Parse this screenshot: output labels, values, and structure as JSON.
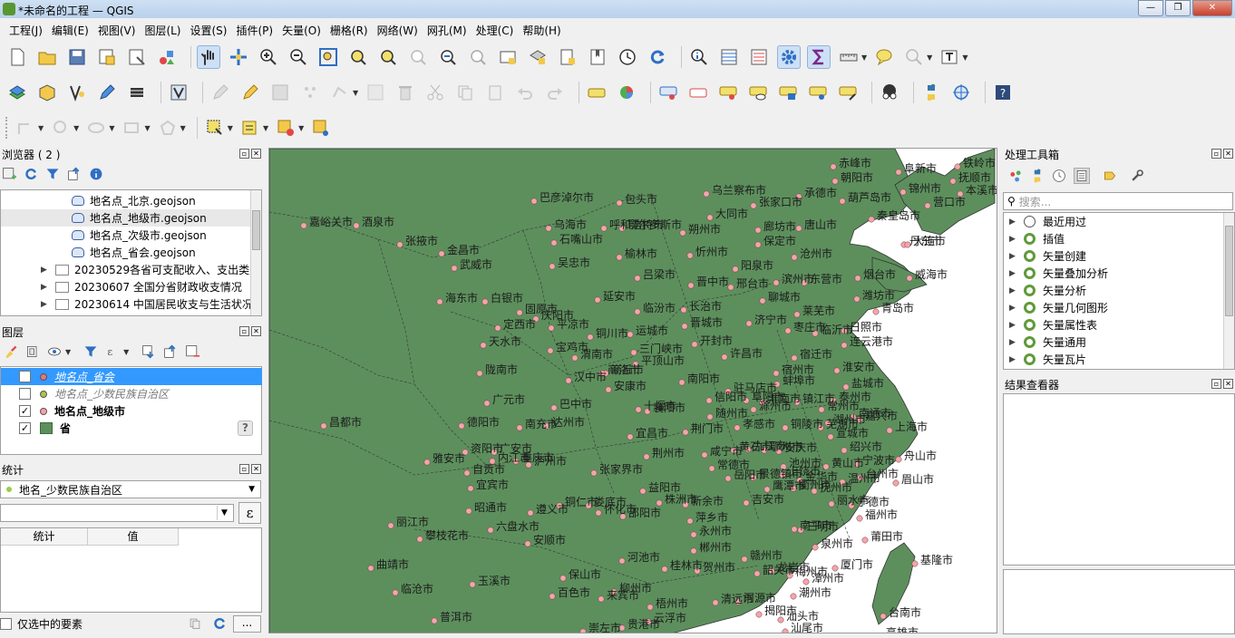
{
  "window": {
    "title": "*未命名的工程 — QGIS",
    "minimize": "—",
    "maximize": "❐",
    "close": "✕"
  },
  "menu": [
    "工程(J)",
    "编辑(E)",
    "视图(V)",
    "图层(L)",
    "设置(S)",
    "插件(P)",
    "矢量(O)",
    "栅格(R)",
    "网络(W)",
    "网孔(M)",
    "处理(C)",
    "帮助(H)"
  ],
  "browser": {
    "title": "浏览器 ( 2 )",
    "items": [
      {
        "label": "地名点_北京.geojson",
        "kind": "file"
      },
      {
        "label": "地名点_地级市.geojson",
        "kind": "file"
      },
      {
        "label": "地名点_次级市.geojson",
        "kind": "file"
      },
      {
        "label": "地名点_省会.geojson",
        "kind": "file"
      },
      {
        "label": "20230529各省可支配收入、支出类别",
        "kind": "folder"
      },
      {
        "label": "20230607 全国分省财政收支情况",
        "kind": "folder"
      },
      {
        "label": "20230614 中国居民收支与生活状况",
        "kind": "folder"
      }
    ]
  },
  "layers": {
    "title": "图层",
    "items": [
      {
        "label": "地名点_省会",
        "checked": false,
        "color": "#d67a86"
      },
      {
        "label": "地名点_少数民族自治区",
        "checked": false,
        "color": "#9acd4a"
      },
      {
        "label": "地名点_地级市",
        "checked": true,
        "color": "#f2a5ad"
      },
      {
        "label": "省",
        "checked": true,
        "color": "#5d8f5d"
      }
    ],
    "help_label": "?"
  },
  "stats": {
    "title": "统计",
    "layer_select": "地名_少数民族自治区",
    "col_stat": "统计",
    "col_value": "值",
    "only_selected": "仅选中的要素",
    "expr_button": "ε",
    "more_button": "..."
  },
  "tools": {
    "title": "处理工具箱",
    "search_placeholder": "搜索...",
    "items": [
      "最近用过",
      "插值",
      "矢量创建",
      "矢量叠加分析",
      "矢量分析",
      "矢量几何图形",
      "矢量属性表",
      "矢量通用",
      "矢量瓦片"
    ]
  },
  "results": {
    "title": "结果查看器"
  },
  "map": {
    "fill": "#5d8f5d",
    "sea": "#ffffff",
    "point_color": "#f2a5ad",
    "labels": [
      "赤峰市",
      "朝阳市",
      "阜新市",
      "铁岭市",
      "抚顺市",
      "锦州市",
      "本溪市",
      "营口市",
      "丹东市",
      "葫芦岛市",
      "秦皇岛市",
      "大连市",
      "乌兰察布市",
      "张家口市",
      "承德市",
      "大同市",
      "廊坊市",
      "唐山市",
      "保定市",
      "沧州市",
      "巴彦淖尔市",
      "包头市",
      "呼和浩特市",
      "乌海市",
      "鄂尔多斯市",
      "朔州市",
      "嘉峪关市",
      "酒泉市",
      "张掖市",
      "金昌市",
      "武威市",
      "石嘴山市",
      "吴忠市",
      "榆林市",
      "忻州市",
      "阳泉市",
      "吕梁市",
      "晋中市",
      "邢台市",
      "滨州市",
      "东营市",
      "烟台市",
      "威海市",
      "潍坊市",
      "青岛市",
      "日照市",
      "临沂市",
      "连云港市",
      "海东市",
      "白银市",
      "固原市",
      "庆阳市",
      "延安市",
      "临汾市",
      "长治市",
      "晋城市",
      "聊城市",
      "莱芜市",
      "济宁市",
      "枣庄市",
      "宿迁市",
      "定西市",
      "平凉市",
      "天水市",
      "宝鸡市",
      "铜川市",
      "渭南市",
      "运城市",
      "三门峡市",
      "开封市",
      "许昌市",
      "商丘市",
      "宿州市",
      "淮安市",
      "盐城市",
      "泰州市",
      "南通市",
      "上海市",
      "陇南市",
      "汉中市",
      "商洛市",
      "安康市",
      "平顶山市",
      "南阳市",
      "驻马店市",
      "阜阳市",
      "蚌埠市",
      "滁州市",
      "淮南市",
      "镇江市",
      "常州市",
      "湖州市",
      "嘉兴市",
      "舟山市",
      "广元市",
      "巴中市",
      "十堰市",
      "襄阳市",
      "信阳市",
      "随州市",
      "孝感市",
      "铜陵市",
      "芜湖市",
      "宣城市",
      "绍兴市",
      "宁波市",
      "台州市",
      "昌都市",
      "德阳市",
      "南充市",
      "达州市",
      "宜昌市",
      "荆门市",
      "荆州市",
      "鄂州市",
      "黄石市",
      "九江市",
      "安庆市",
      "池州市",
      "黄山市",
      "衢州市",
      "金华市",
      "温州市",
      "眉山市",
      "资阳市",
      "广安市",
      "雅安市",
      "内江市",
      "重庆市",
      "泸州市",
      "张家界市",
      "咸宁市",
      "常德市",
      "岳阳市",
      "景德镇市",
      "上饶市",
      "丽水市",
      "自贡市",
      "宜宾市",
      "益阳市",
      "鹰潭市",
      "抚州市",
      "南平市",
      "宁德市",
      "昭通市",
      "遵义市",
      "铜仁市",
      "娄底市",
      "株洲市",
      "新余市",
      "吉安市",
      "三明市",
      "福州市",
      "莆田市",
      "丽江市",
      "攀枝花市",
      "六盘水市",
      "安顺市",
      "怀化市",
      "邵阳市",
      "萍乡市",
      "永州市",
      "郴州市",
      "赣州市",
      "龙岩市",
      "泉州市",
      "厦门市",
      "基隆市",
      "曲靖市",
      "保山市",
      "河池市",
      "桂林市",
      "贺州市",
      "韶关市",
      "梅州市",
      "漳州市",
      "潮州市",
      "汕头市",
      "临沧市",
      "玉溪市",
      "百色市",
      "来宾市",
      "柳州市",
      "梧州市",
      "清远市",
      "河源市",
      "揭阳市",
      "汕尾市",
      "普洱市",
      "贵港市",
      "云浮市",
      "崇左市",
      "台南市",
      "高雄市"
    ]
  }
}
